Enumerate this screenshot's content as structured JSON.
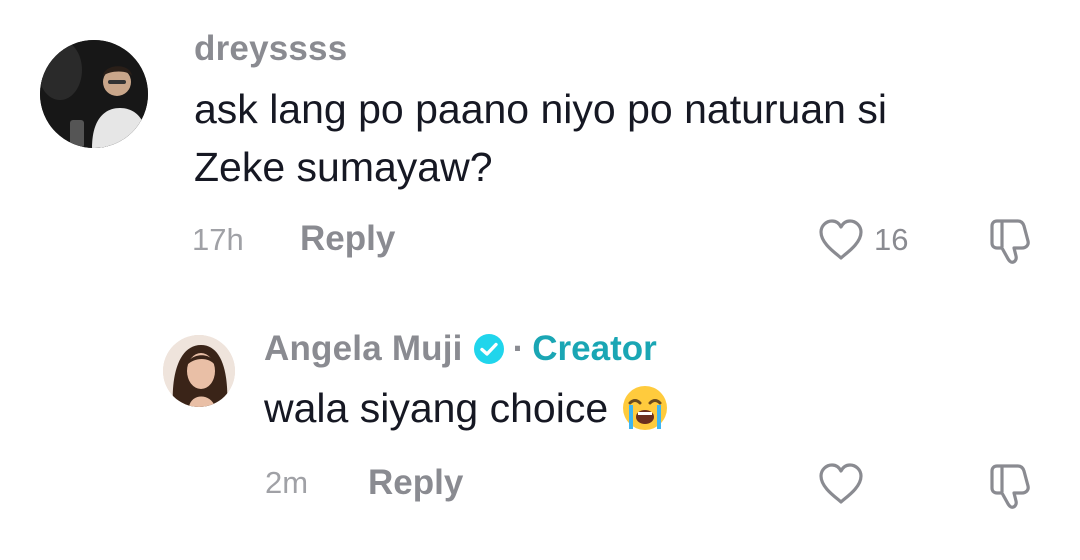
{
  "comments": [
    {
      "username": "dreyssss",
      "text_line1": "ask lang po paano niyo po naturuan si",
      "text_line2": "Zeke sumayaw?",
      "time": "17h",
      "reply_label": "Reply",
      "like_count": "16"
    }
  ],
  "reply": {
    "username": "Angela Muji",
    "separator": "·",
    "creator_badge": "Creator",
    "text": "wala siyang choice",
    "emoji": "loudly-crying-face",
    "time": "2m",
    "reply_label": "Reply",
    "like_count": ""
  },
  "icons": {
    "like": "heart-outline-icon",
    "dislike": "thumbs-down-icon",
    "verified": "verified-check-icon"
  },
  "colors": {
    "username": "#8a8b91",
    "creator": "#1aa6b4",
    "verified": "#20d5ec",
    "text": "#161823",
    "meta": "#a0a1a6"
  }
}
